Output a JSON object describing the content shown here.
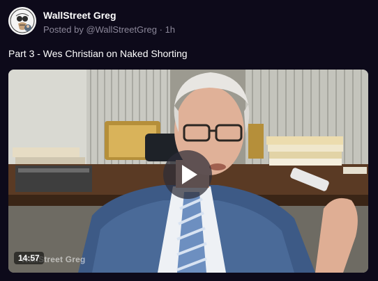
{
  "post": {
    "author": "WallStreet Greg",
    "posted_by_prefix": "Posted by ",
    "handle": "@WallStreetGreg",
    "separator": " · ",
    "time_ago": "1h",
    "title": "Part 3 - Wes Christian on Naked Shorting",
    "avatar_icon": "logo-avatar-icon"
  },
  "video": {
    "duration": "14:57",
    "watermark": "WallStreet Greg",
    "play_icon": "play-icon"
  },
  "colors": {
    "background": "#0d0a1a",
    "text_primary": "#ffffff",
    "text_secondary": "#8b8799"
  }
}
